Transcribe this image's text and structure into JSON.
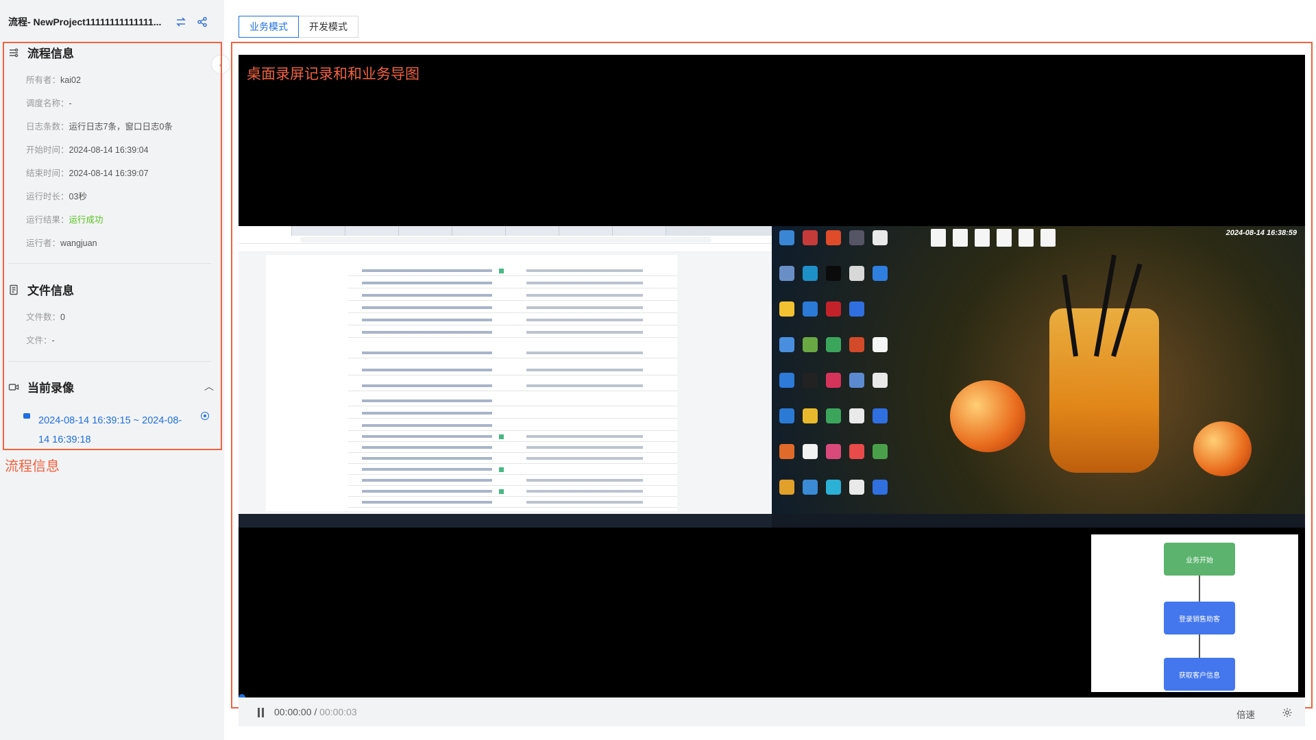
{
  "project": {
    "title": "流程- NewProject11111111111111..."
  },
  "tabs": [
    {
      "label": "业务模式",
      "active": true
    },
    {
      "label": "开发模式",
      "active": false
    }
  ],
  "process_info": {
    "heading": "流程信息",
    "rows": [
      {
        "label": "所有者：",
        "value": "kai02"
      },
      {
        "label": "调度名称：",
        "value": "-"
      },
      {
        "label": "日志条数：",
        "value": "运行日志7条，窗口日志0条"
      },
      {
        "label": "开始时间：",
        "value": "2024-08-14 16:39:04"
      },
      {
        "label": "结束时间：",
        "value": "2024-08-14 16:39:07"
      },
      {
        "label": "运行时长：",
        "value": "03秒"
      },
      {
        "label": "运行结果：",
        "value": "运行成功",
        "status": "success"
      },
      {
        "label": "运行者：",
        "value": "wangjuan"
      }
    ]
  },
  "file_info": {
    "heading": "文件信息",
    "rows": [
      {
        "label": "文件数：",
        "value": "0"
      },
      {
        "label": "文件：",
        "value": "-"
      }
    ]
  },
  "recording": {
    "heading": "当前录像",
    "item": "2024-08-14 16:39:15 ~ 2024-08-14 16:39:18"
  },
  "annotations": {
    "left_label": "流程信息",
    "video_label": "桌面录屏记录和和业务导图"
  },
  "video": {
    "desktop_timestamp": "2024-08-14 16:38:59",
    "flow_nodes": [
      "业务开始",
      "登录销售助客",
      "获取客户信息"
    ]
  },
  "player": {
    "current_time": "00:00:00",
    "separator": " / ",
    "total_time": "00:00:03",
    "speed_label": "倍速",
    "progress": 0
  },
  "colors": {
    "accent": "#1f6fe0",
    "annotation": "#f0623f",
    "success": "#52c41a",
    "flow_start": "#5bb36d",
    "flow_step": "#4477ee"
  }
}
